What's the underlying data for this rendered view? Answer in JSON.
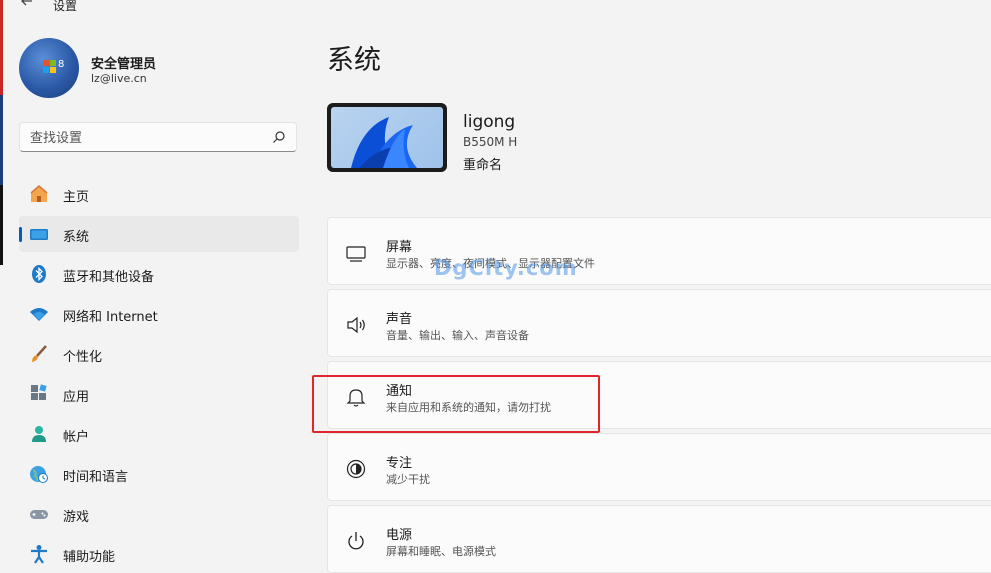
{
  "app": {
    "title": "设置"
  },
  "user": {
    "name": "安全管理员",
    "email": "lz@live.cn"
  },
  "search": {
    "placeholder": "查找设置"
  },
  "sidebar": {
    "items": [
      {
        "label": "主页",
        "icon": "home-icon"
      },
      {
        "label": "系统",
        "icon": "system-display-icon",
        "active": true
      },
      {
        "label": "蓝牙和其他设备",
        "icon": "bluetooth-icon"
      },
      {
        "label": "网络和 Internet",
        "icon": "wifi-icon"
      },
      {
        "label": "个性化",
        "icon": "brush-icon"
      },
      {
        "label": "应用",
        "icon": "apps-icon"
      },
      {
        "label": "帐户",
        "icon": "account-icon"
      },
      {
        "label": "时间和语言",
        "icon": "globe-clock-icon"
      },
      {
        "label": "游戏",
        "icon": "gamepad-icon"
      },
      {
        "label": "辅助功能",
        "icon": "accessibility-icon"
      }
    ]
  },
  "main": {
    "title": "系统",
    "device": {
      "name": "ligong",
      "model": "B550M H",
      "rename": "重命名"
    },
    "cards": [
      {
        "title": "屏幕",
        "subtitle": "显示器、亮度、夜间模式、显示器配置文件",
        "icon": "monitor-icon"
      },
      {
        "title": "声音",
        "subtitle": "音量、输出、输入、声音设备",
        "icon": "speaker-icon"
      },
      {
        "title": "通知",
        "subtitle": "来自应用和系统的通知，请勿打扰",
        "icon": "bell-icon",
        "highlighted": true
      },
      {
        "title": "专注",
        "subtitle": "减少干扰",
        "icon": "focus-icon"
      },
      {
        "title": "电源",
        "subtitle": "屏幕和睡眠、电源模式",
        "icon": "power-icon"
      }
    ]
  },
  "watermark": "DgCity.com",
  "colors": {
    "accent": "#005fb8",
    "highlight": "#e0262a",
    "background": "#f3f3f3"
  }
}
